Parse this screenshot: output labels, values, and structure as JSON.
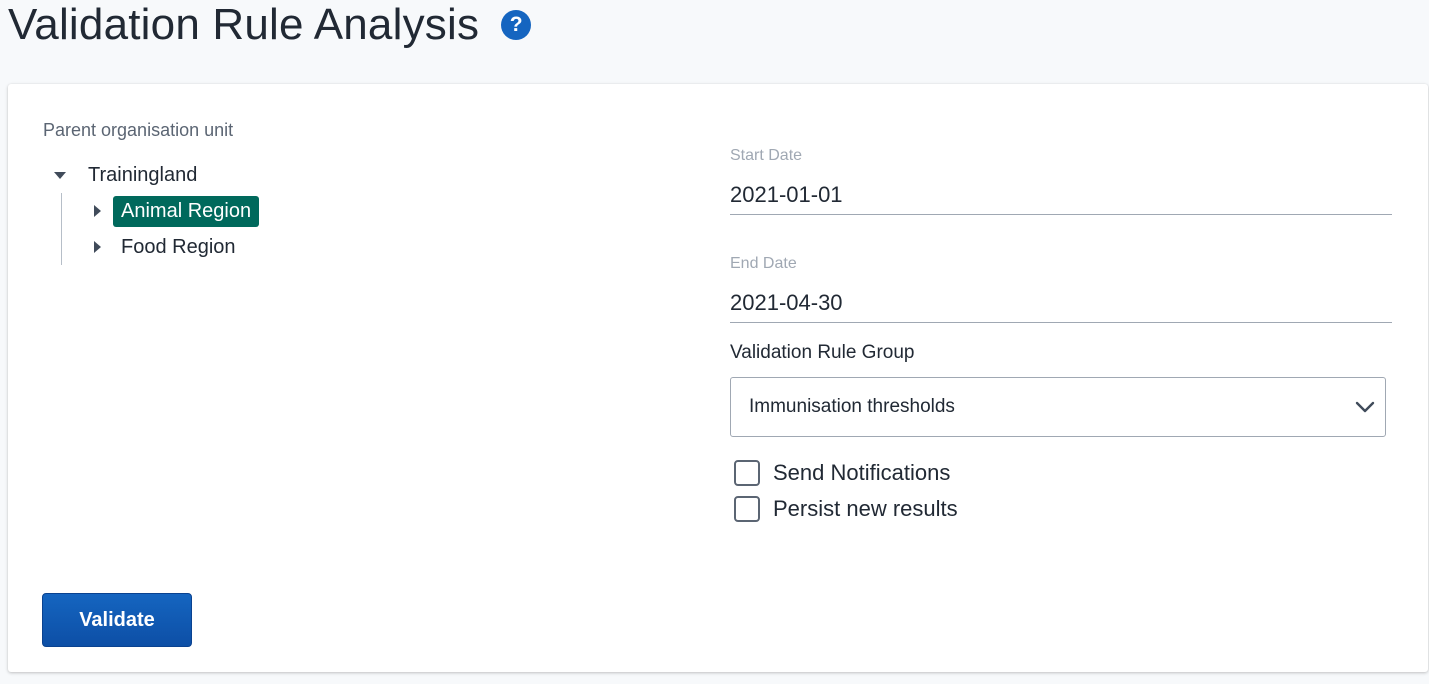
{
  "page": {
    "title": "Validation Rule Analysis",
    "help_icon": "help-icon"
  },
  "org_tree": {
    "label": "Parent organisation unit",
    "root": {
      "label": "Trainingland",
      "expanded": true
    },
    "children": [
      {
        "label": "Animal Region",
        "selected": true
      },
      {
        "label": "Food Region",
        "selected": false
      }
    ]
  },
  "form": {
    "start_date": {
      "label": "Start Date",
      "value": "2021-01-01"
    },
    "end_date": {
      "label": "End Date",
      "value": "2021-04-30"
    },
    "rule_group": {
      "label": "Validation Rule Group",
      "value": "Immunisation thresholds"
    },
    "send_notifications": {
      "label": "Send Notifications",
      "checked": false
    },
    "persist_results": {
      "label": "Persist new results",
      "checked": false
    }
  },
  "actions": {
    "validate_label": "Validate"
  },
  "colors": {
    "primary": "#1565c0",
    "selected_node": "#00695c",
    "background": "#f7f9fb"
  }
}
